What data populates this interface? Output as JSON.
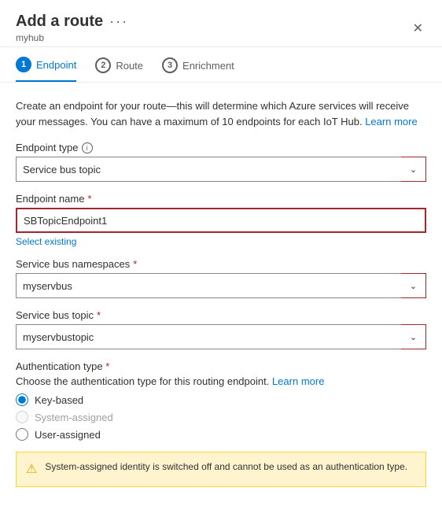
{
  "header": {
    "title": "Add a route",
    "subtitle": "myhub",
    "dots_label": "···"
  },
  "steps": [
    {
      "number": "1",
      "label": "Endpoint",
      "active": true
    },
    {
      "number": "2",
      "label": "Route",
      "active": false
    },
    {
      "number": "3",
      "label": "Enrichment",
      "active": false
    }
  ],
  "description": "Create an endpoint for your route—this will determine which Azure services will receive your messages. You can have a maximum of 10 endpoints for each IoT Hub.",
  "learn_more_label": "Learn more",
  "fields": {
    "endpoint_type": {
      "label": "Endpoint type",
      "value": "Service bus topic",
      "required": false
    },
    "endpoint_name": {
      "label": "Endpoint name",
      "value": "SBTopicEndpoint1",
      "placeholder": "SBTopicEndpoint1",
      "required": true
    },
    "select_existing": "Select existing",
    "service_bus_namespace": {
      "label": "Service bus namespaces",
      "value": "myservbus",
      "required": true
    },
    "service_bus_topic": {
      "label": "Service bus topic",
      "value": "myservbustopic",
      "required": true
    }
  },
  "authentication": {
    "title": "Authentication type",
    "required": true,
    "description": "Choose the authentication type for this routing endpoint.",
    "learn_more_label": "Learn more",
    "options": [
      {
        "value": "key-based",
        "label": "Key-based",
        "checked": true,
        "disabled": false
      },
      {
        "value": "system-assigned",
        "label": "System-assigned",
        "checked": false,
        "disabled": true
      },
      {
        "value": "user-assigned",
        "label": "User-assigned",
        "checked": false,
        "disabled": false
      }
    ]
  },
  "warning": {
    "text": "System-assigned identity is switched off and cannot be used as an authentication type."
  },
  "icons": {
    "close": "✕",
    "chevron_down": "⌄",
    "info": "i",
    "warning": "⚠"
  }
}
